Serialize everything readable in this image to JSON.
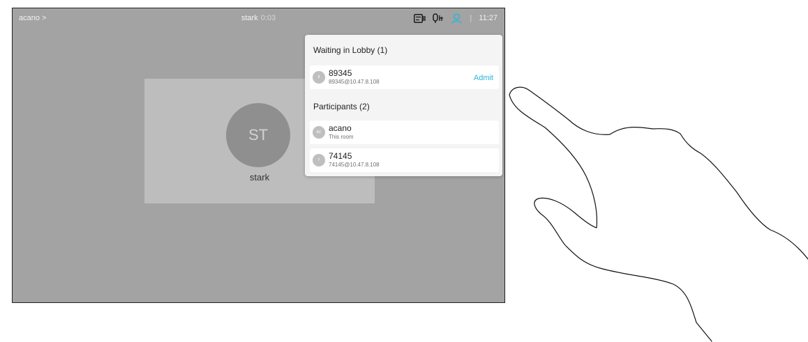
{
  "topbar": {
    "room_name": "acano >",
    "call_name": "stark",
    "call_time": "0:03",
    "separator": "|",
    "clock": "11:27",
    "icons": [
      "self-view-icon",
      "mic-icon",
      "participants-icon"
    ],
    "participants_icon_color": "#28b6d8"
  },
  "main": {
    "tile_initials": "ST",
    "tile_name": "stark"
  },
  "panel": {
    "lobby_title": "Waiting in Lobby (1)",
    "lobby": [
      {
        "initials": "8",
        "name": "89345",
        "address": "89345@10.47.8.108",
        "action": "Admit"
      }
    ],
    "participants_title": "Participants (2)",
    "participants": [
      {
        "initials": "AC",
        "name": "acano",
        "subtitle": "This room"
      },
      {
        "initials": "7",
        "name": "74145",
        "subtitle": "74145@10.47.8.108"
      }
    ]
  }
}
